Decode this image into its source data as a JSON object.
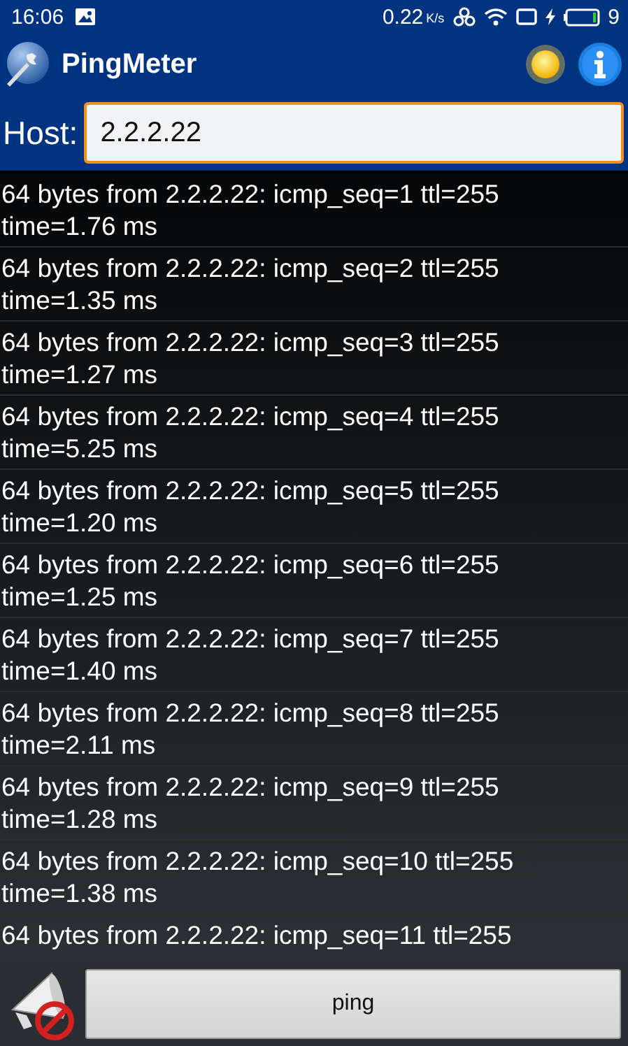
{
  "status_bar": {
    "time": "16:06",
    "speed": "0.22",
    "speed_unit": "K/s",
    "battery": "9"
  },
  "app_bar": {
    "title": "PingMeter"
  },
  "host": {
    "label": "Host:",
    "value": "2.2.2.22"
  },
  "results": [
    {
      "reply": "64 bytes from 2.2.2.22: icmp_seq=1 ttl=255",
      "time": "time=1.76 ms"
    },
    {
      "reply": "64 bytes from 2.2.2.22: icmp_seq=2 ttl=255",
      "time": "time=1.35 ms"
    },
    {
      "reply": "64 bytes from 2.2.2.22: icmp_seq=3 ttl=255",
      "time": "time=1.27 ms"
    },
    {
      "reply": "64 bytes from 2.2.2.22: icmp_seq=4 ttl=255",
      "time": "time=5.25 ms"
    },
    {
      "reply": "64 bytes from 2.2.2.22: icmp_seq=5 ttl=255",
      "time": "time=1.20 ms"
    },
    {
      "reply": "64 bytes from 2.2.2.22: icmp_seq=6 ttl=255",
      "time": "time=1.25 ms"
    },
    {
      "reply": "64 bytes from 2.2.2.22: icmp_seq=7 ttl=255",
      "time": "time=1.40 ms"
    },
    {
      "reply": "64 bytes from 2.2.2.22: icmp_seq=8 ttl=255",
      "time": "time=2.11 ms"
    },
    {
      "reply": "64 bytes from 2.2.2.22: icmp_seq=9 ttl=255",
      "time": "time=1.28 ms"
    },
    {
      "reply": "64 bytes from 2.2.2.22: icmp_seq=10 ttl=255",
      "time": "time=1.38 ms"
    },
    {
      "reply": "64 bytes from 2.2.2.22: icmp_seq=11 ttl=255"
    }
  ],
  "ping_button": {
    "label": "ping"
  }
}
